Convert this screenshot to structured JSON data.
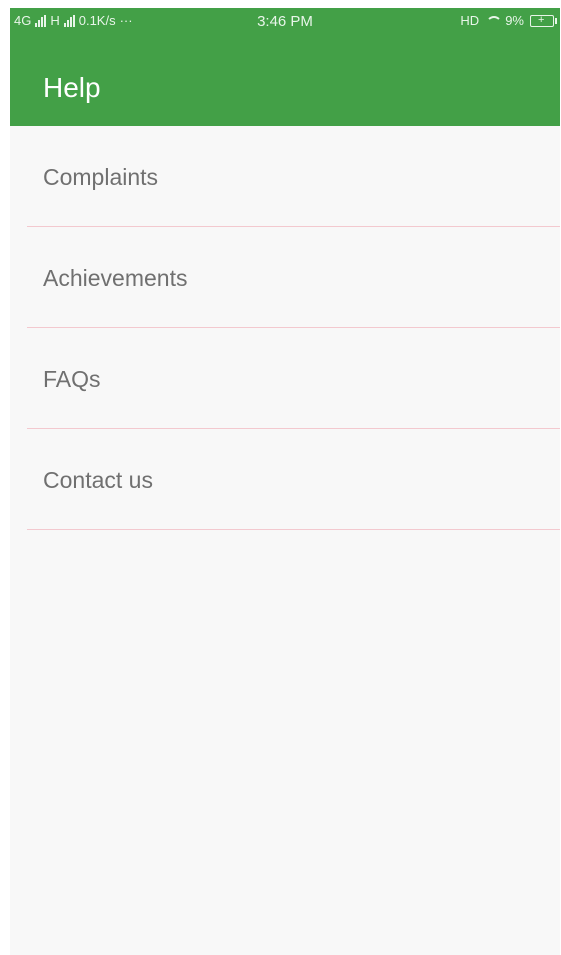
{
  "status_bar": {
    "network_1": "4G",
    "network_2": "H",
    "speed": "0.1K/s",
    "more": "···",
    "time": "3:46 PM",
    "volte": "HD",
    "battery_percent": "9%"
  },
  "app_bar": {
    "title": "Help",
    "color": "#43a047"
  },
  "menu": {
    "items": [
      {
        "label": "Complaints"
      },
      {
        "label": "Achievements"
      },
      {
        "label": "FAQs"
      },
      {
        "label": "Contact us"
      }
    ],
    "divider_color": "#f3c9cf"
  }
}
